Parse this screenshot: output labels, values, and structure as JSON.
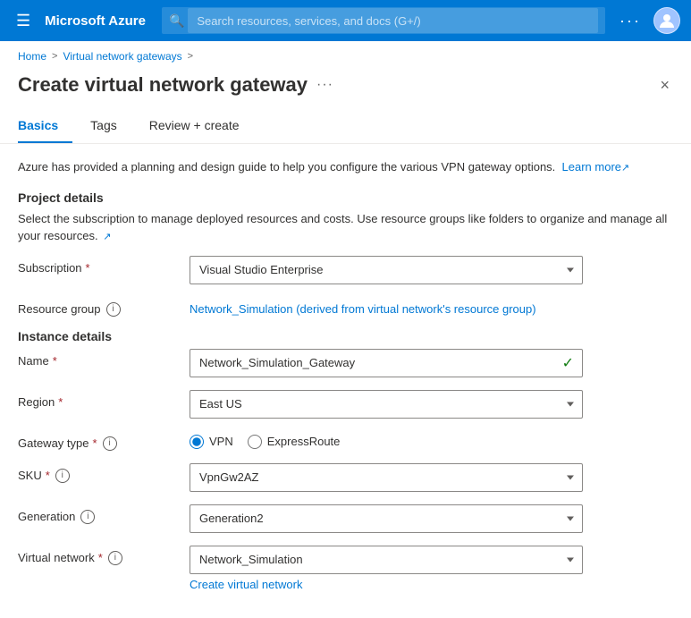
{
  "nav": {
    "hamburger_label": "☰",
    "title": "Microsoft Azure",
    "search_placeholder": "Search resources, services, and docs (G+/)",
    "dots_label": "···",
    "avatar_label": "User"
  },
  "breadcrumb": {
    "home": "Home",
    "separator1": ">",
    "virtual_network_gateways": "Virtual network gateways",
    "separator2": ">"
  },
  "page": {
    "title": "Create virtual network gateway",
    "dots_label": "···",
    "close_label": "×"
  },
  "tabs": [
    {
      "id": "basics",
      "label": "Basics",
      "active": true
    },
    {
      "id": "tags",
      "label": "Tags",
      "active": false
    },
    {
      "id": "review",
      "label": "Review + create",
      "active": false
    }
  ],
  "info_banner": {
    "text": "Azure has provided a planning and design guide to help you configure the various VPN gateway options.",
    "link_text": "Learn more",
    "ext_icon": "↗"
  },
  "project_details": {
    "title": "Project details",
    "description": "Select the subscription to manage deployed resources and costs. Use resource groups like folders to organize and manage all your resources.",
    "ext_icon": "↗",
    "subscription": {
      "label": "Subscription",
      "required": true,
      "value": "Visual Studio Enterprise",
      "options": [
        "Visual Studio Enterprise"
      ]
    },
    "resource_group": {
      "label": "Resource group",
      "has_info": true,
      "value": "Network_Simulation (derived from virtual network's resource group)"
    }
  },
  "instance_details": {
    "title": "Instance details",
    "name": {
      "label": "Name",
      "required": true,
      "value": "Network_Simulation_Gateway",
      "has_checkmark": true
    },
    "region": {
      "label": "Region",
      "required": true,
      "value": "East US",
      "options": [
        "East US"
      ]
    },
    "gateway_type": {
      "label": "Gateway type",
      "required": true,
      "has_info": true,
      "options": [
        "VPN",
        "ExpressRoute"
      ],
      "selected": "VPN"
    },
    "sku": {
      "label": "SKU",
      "required": true,
      "has_info": true,
      "value": "VpnGw2AZ",
      "options": [
        "VpnGw2AZ"
      ]
    },
    "generation": {
      "label": "Generation",
      "has_info": true,
      "value": "Generation2",
      "options": [
        "Generation2"
      ]
    },
    "virtual_network": {
      "label": "Virtual network",
      "required": true,
      "has_info": true,
      "value": "Network_Simulation",
      "options": [
        "Network_Simulation"
      ],
      "create_link": "Create virtual network"
    }
  }
}
